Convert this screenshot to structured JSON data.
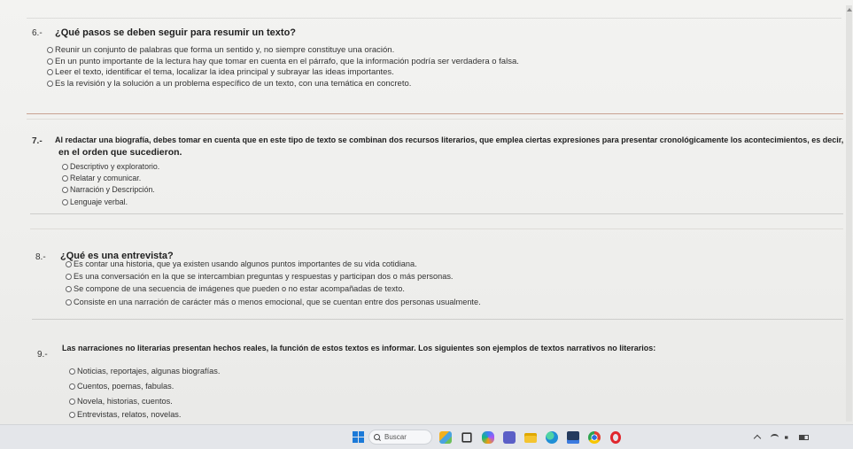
{
  "questions": [
    {
      "number": "6.-",
      "text": "¿Qué pasos se deben seguir para resumir un texto?",
      "options": [
        "Reunir un conjunto de palabras que forma un sentido y, no siempre constituye una oración.",
        "En un punto importante de la lectura hay que tomar en cuenta en el párrafo, que la información podría ser verdadera o falsa.",
        "Leer el texto, identificar el tema, localizar la idea principal y subrayar las ideas importantes.",
        "Es la revisión y la solución a un problema específico de un texto, con una temática en concreto."
      ]
    },
    {
      "number": "7.-",
      "text": "Al redactar una biografía, debes tomar en cuenta que en este tipo de texto se combinan dos recursos literarios, que emplea ciertas expresiones para presentar cronológicamente los acontecimientos, es decir,",
      "text_continued": "en el orden que sucedieron.",
      "options": [
        "Descriptivo y exploratorio.",
        "Relatar y comunicar.",
        "Narración y Descripción.",
        "Lenguaje verbal."
      ]
    },
    {
      "number": "8.-",
      "text": "¿Qué es una entrevista?",
      "options": [
        "Es contar una historia, que ya existen usando algunos puntos importantes de su vida cotidiana.",
        "Es una conversación en la que se intercambian preguntas y respuestas y participan dos o más personas.",
        "Se compone de una secuencia de imágenes que pueden o no estar acompañadas de texto.",
        "Consiste en una narración de carácter más o menos emocional, que se cuentan entre dos personas usualmente."
      ]
    },
    {
      "number": "9.-",
      "text": "Las narraciones no literarias presentan hechos reales, la función de estos textos es informar. Los siguientes son ejemplos de textos narrativos no literarios:",
      "options": [
        "Noticias, reportajes, algunas biografías.",
        "Cuentos, poemas, fabulas.",
        "Novela, historias, cuentos.",
        "Entrevistas, relatos, novelas."
      ]
    }
  ],
  "taskbar": {
    "search_placeholder": "Buscar",
    "start_icon": "windows-start-icon",
    "pinned_icons": [
      "widgets-icon",
      "task-view-icon",
      "copilot-icon",
      "chat-icon",
      "file-explorer-icon",
      "edge-icon",
      "store-icon",
      "chrome-icon",
      "opera-icon"
    ],
    "tray_icons": [
      "chevron-up-icon",
      "wifi-icon",
      "volume-icon",
      "battery-icon"
    ]
  },
  "colors": {
    "page_background": "#eeeeec",
    "separator": "#cdcdcb",
    "separator_accent": "#c9a292",
    "text": "#2b2b2b",
    "taskbar": "#e4e6ea",
    "start_blue": "#1c7ad8"
  }
}
